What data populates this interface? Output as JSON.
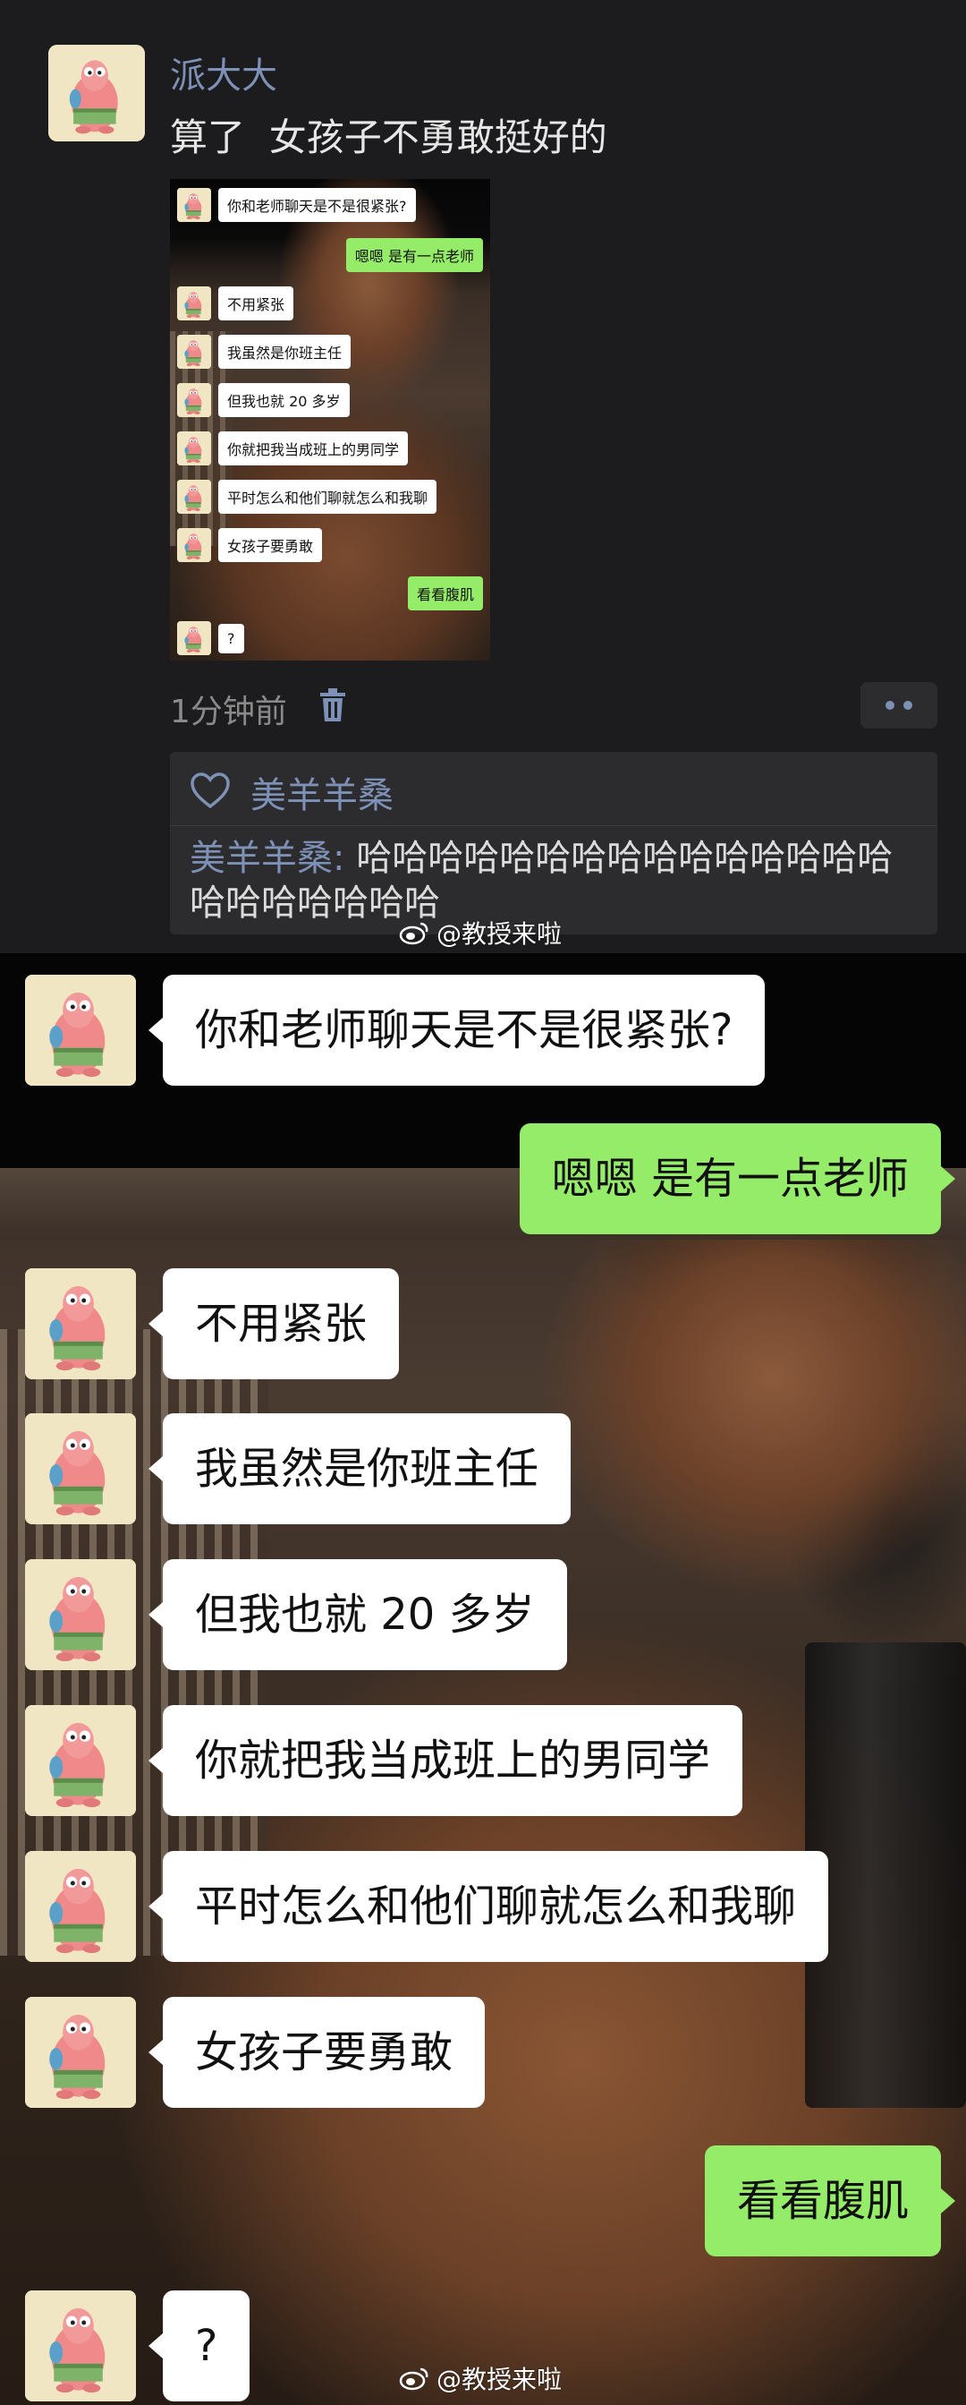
{
  "post": {
    "author": "派大大",
    "text": "算了  女孩子不勇敢挺好的",
    "time": "1分钟前",
    "icons": [
      "trash-icon",
      "more-dots-icon",
      "heart-icon"
    ],
    "likes": {
      "name": "美羊羊桑"
    },
    "comment": {
      "author": "美羊羊桑",
      "separator": ": ",
      "text": "哈哈哈哈哈哈哈哈哈哈哈哈哈哈哈哈哈哈哈哈哈哈"
    }
  },
  "chat": {
    "messages": [
      {
        "side": "left",
        "text": "你和老师聊天是不是很紧张?"
      },
      {
        "side": "right",
        "text": "嗯嗯 是有一点老师"
      },
      {
        "side": "left",
        "text": "不用紧张"
      },
      {
        "side": "left",
        "text": "我虽然是你班主任"
      },
      {
        "side": "left",
        "text": "但我也就 20 多岁"
      },
      {
        "side": "left",
        "text": "你就把我当成班上的男同学"
      },
      {
        "side": "left",
        "text": "平时怎么和他们聊就怎么和我聊"
      },
      {
        "side": "left",
        "text": "女孩子要勇敢"
      },
      {
        "side": "right",
        "text": "看看腹肌"
      },
      {
        "side": "left",
        "text": "?"
      }
    ]
  },
  "watermark": {
    "text": "@教授来啦",
    "icon": "weibo-icon"
  },
  "colors": {
    "background": "#1c1c1e",
    "link_blue": "#7d90b5",
    "bubble_green": "#95ec69",
    "bubble_white": "#ffffff"
  }
}
